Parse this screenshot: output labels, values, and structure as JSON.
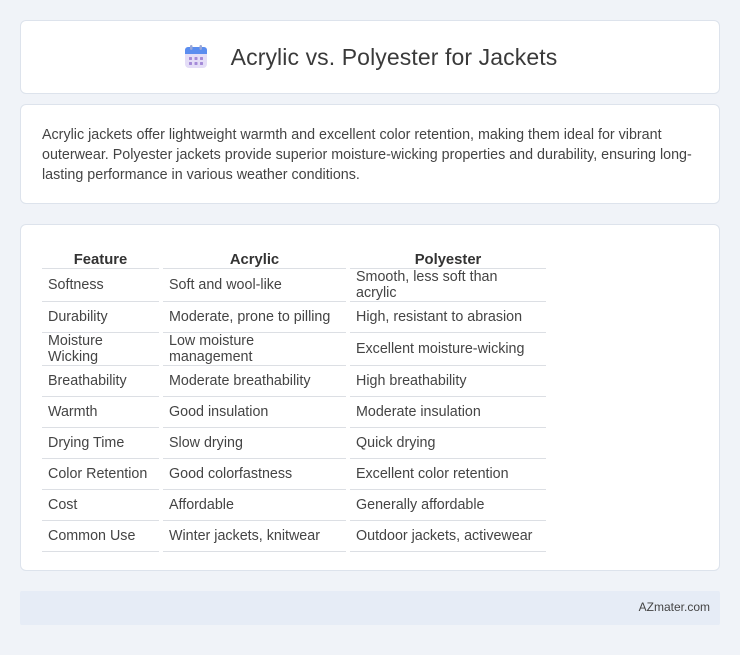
{
  "header": {
    "title": "Acrylic vs. Polyester for Jackets",
    "icon": "calendar-icon"
  },
  "intro": {
    "text": "Acrylic jackets offer lightweight warmth and excellent color retention, making them ideal for vibrant outerwear. Polyester jackets provide superior moisture-wicking properties and durability, ensuring long-lasting performance in various weather conditions."
  },
  "table": {
    "headers": [
      "Feature",
      "Acrylic",
      "Polyester"
    ],
    "rows": [
      [
        "Softness",
        "Soft and wool-like",
        "Smooth, less soft than acrylic"
      ],
      [
        "Durability",
        "Moderate, prone to pilling",
        "High, resistant to abrasion"
      ],
      [
        "Moisture Wicking",
        "Low moisture management",
        "Excellent moisture-wicking"
      ],
      [
        "Breathability",
        "Moderate breathability",
        "High breathability"
      ],
      [
        "Warmth",
        "Good insulation",
        "Moderate insulation"
      ],
      [
        "Drying Time",
        "Slow drying",
        "Quick drying"
      ],
      [
        "Color Retention",
        "Good colorfastness",
        "Excellent color retention"
      ],
      [
        "Cost",
        "Affordable",
        "Generally affordable"
      ],
      [
        "Common Use",
        "Winter jackets, knitwear",
        "Outdoor jackets, activewear"
      ]
    ]
  },
  "footer": {
    "text": "AZmater.com"
  }
}
